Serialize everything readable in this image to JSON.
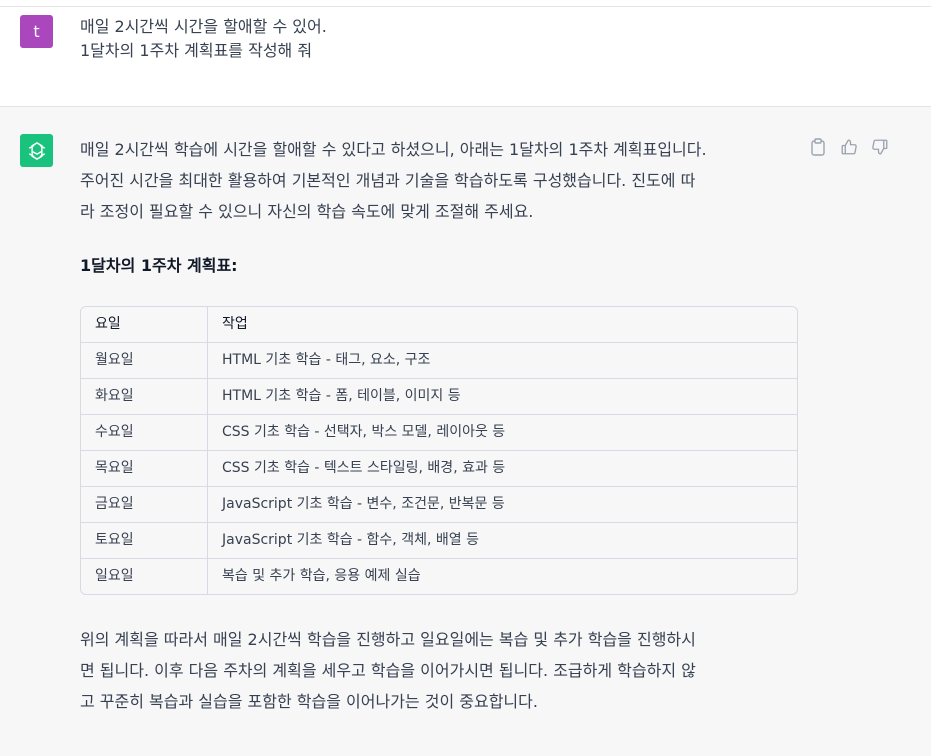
{
  "user": {
    "avatar_letter": "t",
    "avatar_color": "#ab47bc",
    "lines": [
      "매일 2시간씩 시간을 할애할 수 있어.",
      "1달차의 1주차 계획표를 작성해 줘"
    ]
  },
  "assistant": {
    "avatar_icon": "openai-logo-icon",
    "avatar_color": "#19c37d",
    "intro_lines": [
      "매일 2시간씩 학습에 시간을 할애할 수 있다고 하셨으니, 아래는 1달차의 1주차 계획표입니다.",
      "주어진 시간을 최대한 활용하여 기본적인 개념과 기술을 학습하도록 구성했습니다. 진도에 따",
      "라 조정이 필요할 수 있으니 자신의 학습 속도에 맞게 조절해 주세요."
    ],
    "heading": "1달차의 1주차 계획표:",
    "table": {
      "headers": [
        "요일",
        "작업"
      ],
      "rows": [
        [
          "월요일",
          "HTML 기초 학습 - 태그, 요소, 구조"
        ],
        [
          "화요일",
          "HTML 기초 학습 - 폼, 테이블, 이미지 등"
        ],
        [
          "수요일",
          "CSS 기초 학습 - 선택자, 박스 모델, 레이아웃 등"
        ],
        [
          "목요일",
          "CSS 기초 학습 - 텍스트 스타일링, 배경, 효과 등"
        ],
        [
          "금요일",
          "JavaScript 기초 학습 - 변수, 조건문, 반복문 등"
        ],
        [
          "토요일",
          "JavaScript 기초 학습 - 함수, 객체, 배열 등"
        ],
        [
          "일요일",
          "복습 및 추가 학습, 응용 예제 실습"
        ]
      ]
    },
    "closing_lines": [
      "위의 계획을 따라서 매일 2시간씩 학습을 진행하고 일요일에는 복습 및 추가 학습을 진행하시",
      "면 됩니다. 이후 다음 주차의 계획을 세우고 학습을 이어가시면 됩니다. 조급하게 학습하지 않",
      "고 꾸준히 복습과 실습을 포함한 학습을 이어나가는 것이 중요합니다."
    ],
    "actions": [
      "copy-icon",
      "thumbs-up-icon",
      "thumbs-down-icon"
    ]
  }
}
